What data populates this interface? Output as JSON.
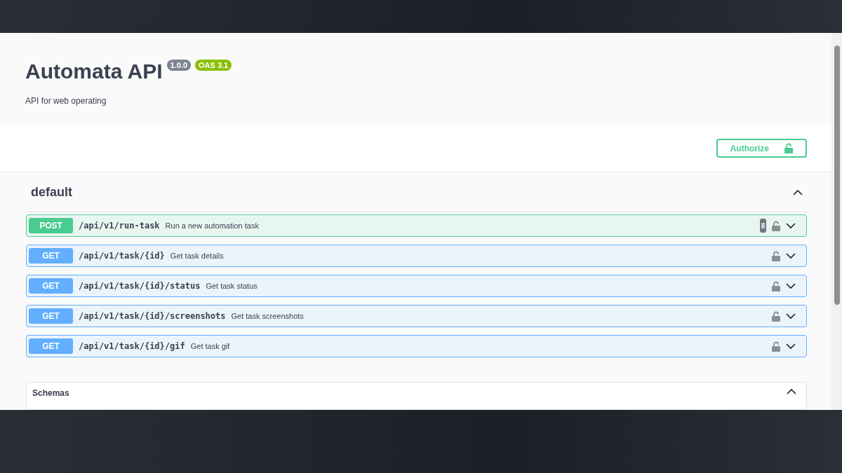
{
  "info": {
    "title": "Automata API",
    "version": "1.0.0",
    "oas": "OAS 3.1",
    "description": "API for web operating"
  },
  "authorize": {
    "label": "Authorize"
  },
  "section": {
    "name": "default",
    "expanded": true
  },
  "operations": [
    {
      "method": "POST",
      "kind": "post",
      "path": "/api/v1/run-task",
      "summary": "Run a new automation task",
      "hovered": true
    },
    {
      "method": "GET",
      "kind": "get",
      "path": "/api/v1/task/{id}",
      "summary": "Get task details",
      "hovered": false
    },
    {
      "method": "GET",
      "kind": "get",
      "path": "/api/v1/task/{id}/status",
      "summary": "Get task status",
      "hovered": false
    },
    {
      "method": "GET",
      "kind": "get",
      "path": "/api/v1/task/{id}/screenshots",
      "summary": "Get task screenshots",
      "hovered": false
    },
    {
      "method": "GET",
      "kind": "get",
      "path": "/api/v1/task/{id}/gif",
      "summary": "Get task gif",
      "hovered": false
    }
  ],
  "schemas": {
    "title": "Schemas",
    "expanded": true
  }
}
